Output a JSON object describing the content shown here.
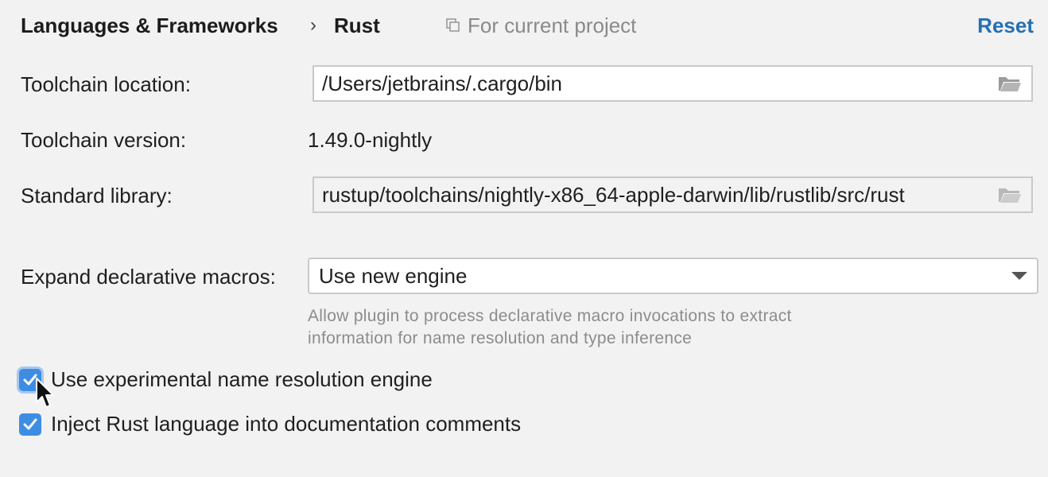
{
  "header": {
    "breadcrumb_parent": "Languages & Frameworks",
    "breadcrumb_separator": "›",
    "breadcrumb_current": "Rust",
    "scope_label": "For current project",
    "reset_label": "Reset"
  },
  "toolchain_location": {
    "label": "Toolchain location:",
    "value": "/Users/jetbrains/.cargo/bin"
  },
  "toolchain_version": {
    "label": "Toolchain version:",
    "value": "1.49.0-nightly"
  },
  "standard_library": {
    "label": "Standard library:",
    "value": "rustup/toolchains/nightly-x86_64-apple-darwin/lib/rustlib/src/rust"
  },
  "expand_macros": {
    "label": "Expand declarative macros:",
    "selected": "Use new engine",
    "hint_line1": "Allow plugin to process declarative macro invocations to extract",
    "hint_line2": "information for name resolution and type inference"
  },
  "checkboxes": [
    {
      "label": "Use experimental name resolution engine",
      "checked": true
    },
    {
      "label": "Inject Rust language into documentation comments",
      "checked": true
    }
  ],
  "colors": {
    "accent": "#3d8ee3",
    "link": "#2470b3",
    "background": "#f2f2f2",
    "hint_text": "#8c8c8c"
  },
  "icons": {
    "scope": "copy-icon",
    "browse": "folder-icon",
    "dropdown": "chevron-down-icon",
    "check": "checkmark-icon",
    "pointer": "mouse-cursor-icon"
  }
}
